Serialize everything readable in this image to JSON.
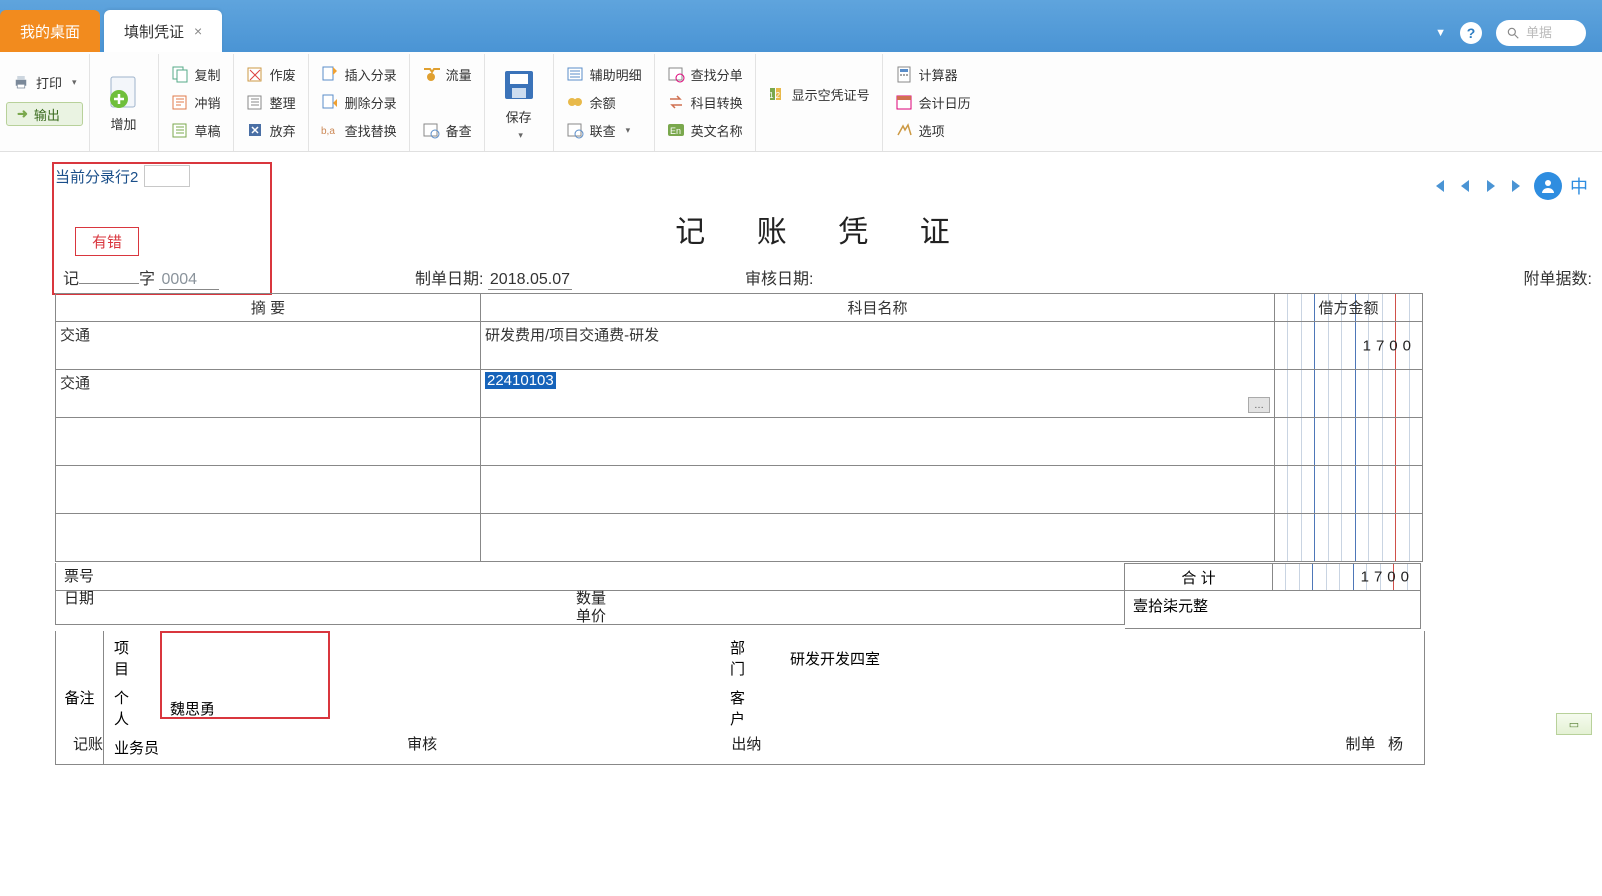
{
  "tabs": {
    "desktop": "我的桌面",
    "voucher": "填制凭证"
  },
  "search": {
    "placeholder": "单据"
  },
  "ribbon": {
    "print": "打印",
    "export": "输出",
    "add": "增加",
    "copy": "复制",
    "reverse": "冲销",
    "draft": "草稿",
    "cancel": "作废",
    "tidy": "整理",
    "discard": "放弃",
    "insert": "插入分录",
    "delete": "删除分录",
    "replace": "查找替换",
    "flow": "流量",
    "remark_btn": "备查",
    "save": "保存",
    "aux": "辅助明细",
    "balance": "余额",
    "link": "联查",
    "find": "查找分单",
    "convert": "科目转换",
    "eng": "英文名称",
    "showempty": "显示空凭证号",
    "calc": "计算器",
    "calendar": "会计日历",
    "options": "选项"
  },
  "current_line_label": "当前分录行2",
  "error_label": "有错",
  "voucher_prefix": "记",
  "voucher_word": "字",
  "voucher_no": "0004",
  "prep_date_label": "制单日期:",
  "prep_date": "2018.05.07",
  "audit_date_label": "审核日期:",
  "attach_label": "附单据数:",
  "title": "记 账 凭 证",
  "headers": {
    "summary": "摘 要",
    "subject": "科目名称",
    "debit": "借方金额"
  },
  "rows": [
    {
      "summary": "交通",
      "subject": "研发费用/项目交通费-研发",
      "debit": "1700"
    },
    {
      "summary": "交通",
      "subject": "22410103",
      "debit": "",
      "highlight": true,
      "lookup": true
    },
    {
      "summary": "",
      "subject": "",
      "debit": ""
    },
    {
      "summary": "",
      "subject": "",
      "debit": ""
    },
    {
      "summary": "",
      "subject": "",
      "debit": ""
    }
  ],
  "ticket_label": "票号",
  "date_label": "日期",
  "qty_label": "数量",
  "price_label": "单价",
  "total_label": "合 计",
  "total_debit": "1700",
  "total_cn": "壹拾柒元整",
  "remark_label": "备注",
  "remark_fields": {
    "project": "项 目",
    "project_v": "",
    "dept": "部 门",
    "dept_v": "研发开发四室",
    "person": "个 人",
    "person_v": "魏思勇",
    "customer": "客 户",
    "customer_v": "",
    "salesman": "业务员",
    "salesman_v": ""
  },
  "footer": {
    "account": "记账",
    "audit": "审核",
    "cashier": "出纳",
    "prepare": "制单",
    "preparer": "杨"
  }
}
